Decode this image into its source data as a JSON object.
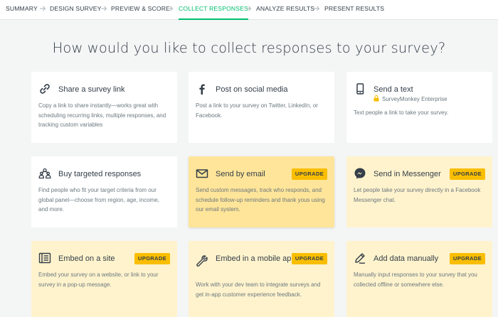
{
  "nav": {
    "steps": [
      {
        "label": "SUMMARY",
        "active": false
      },
      {
        "label": "DESIGN SURVEY",
        "active": false
      },
      {
        "label": "PREVIEW & SCORE",
        "active": false
      },
      {
        "label": "COLLECT RESPONSES",
        "active": true
      },
      {
        "label": "ANALYZE RESULTS",
        "active": false
      },
      {
        "label": "PRESENT RESULTS",
        "active": false
      }
    ]
  },
  "heading": "How would you like to collect responses to your survey?",
  "colors": {
    "accent": "#00bf6f",
    "upgrade_badge": "#f9be00",
    "upgrade_card": "#fff3cd",
    "hover_card": "#ffe599"
  },
  "upgrade_label": "UPGRADE",
  "cards": [
    {
      "key": "survey-link",
      "icon": "link-icon",
      "title": "Share a survey link",
      "description": "Copy a link to share instantly—works great with scheduling recurring links, multiple responses, and tracking custom variables",
      "upgrade": false
    },
    {
      "key": "social-media",
      "icon": "facebook-icon",
      "title": "Post on social media",
      "description": "Post a link to your survey on Twitter, LinkedIn, or Facebook.",
      "upgrade": false
    },
    {
      "key": "text",
      "icon": "smartphone-icon",
      "title": "Send a text",
      "subtitle": "SurveyMonkey Enterprise",
      "subtitle_icon": "lock-icon",
      "description": "Text people a link to take your survey.",
      "upgrade": false
    },
    {
      "key": "targeted-responses",
      "icon": "people-group-icon",
      "title": "Buy targeted responses",
      "description": "Find people who fit your target criteria from our global panel—choose from region, age, income, and more.",
      "upgrade": false
    },
    {
      "key": "email",
      "icon": "envelope-icon",
      "title": "Send by email",
      "description": "Send custom messages, track who responds, and schedule follow-up reminders and thank yous using our email system.",
      "upgrade": true
    },
    {
      "key": "messenger",
      "icon": "messenger-icon",
      "title": "Send in Messenger",
      "description": "Let people take your survey directly in a Facebook Messenger chat.",
      "upgrade": true
    },
    {
      "key": "embed-site",
      "icon": "embed-window-icon",
      "title": "Embed on a site",
      "description": "Embed your survey on a website, or link to your survey in a pop-up message.",
      "upgrade": true
    },
    {
      "key": "mobile-app",
      "icon": "wrench-icon",
      "title": "Embed in a mobile app",
      "description": "Work with your dev team to integrate surveys and get in-app customer experience feedback.",
      "upgrade": true
    },
    {
      "key": "manual-entry",
      "icon": "pencil-icon",
      "title": "Add data manually",
      "description": "Manually input responses to your survey that you collected offline or somewhere else.",
      "upgrade": true
    }
  ]
}
